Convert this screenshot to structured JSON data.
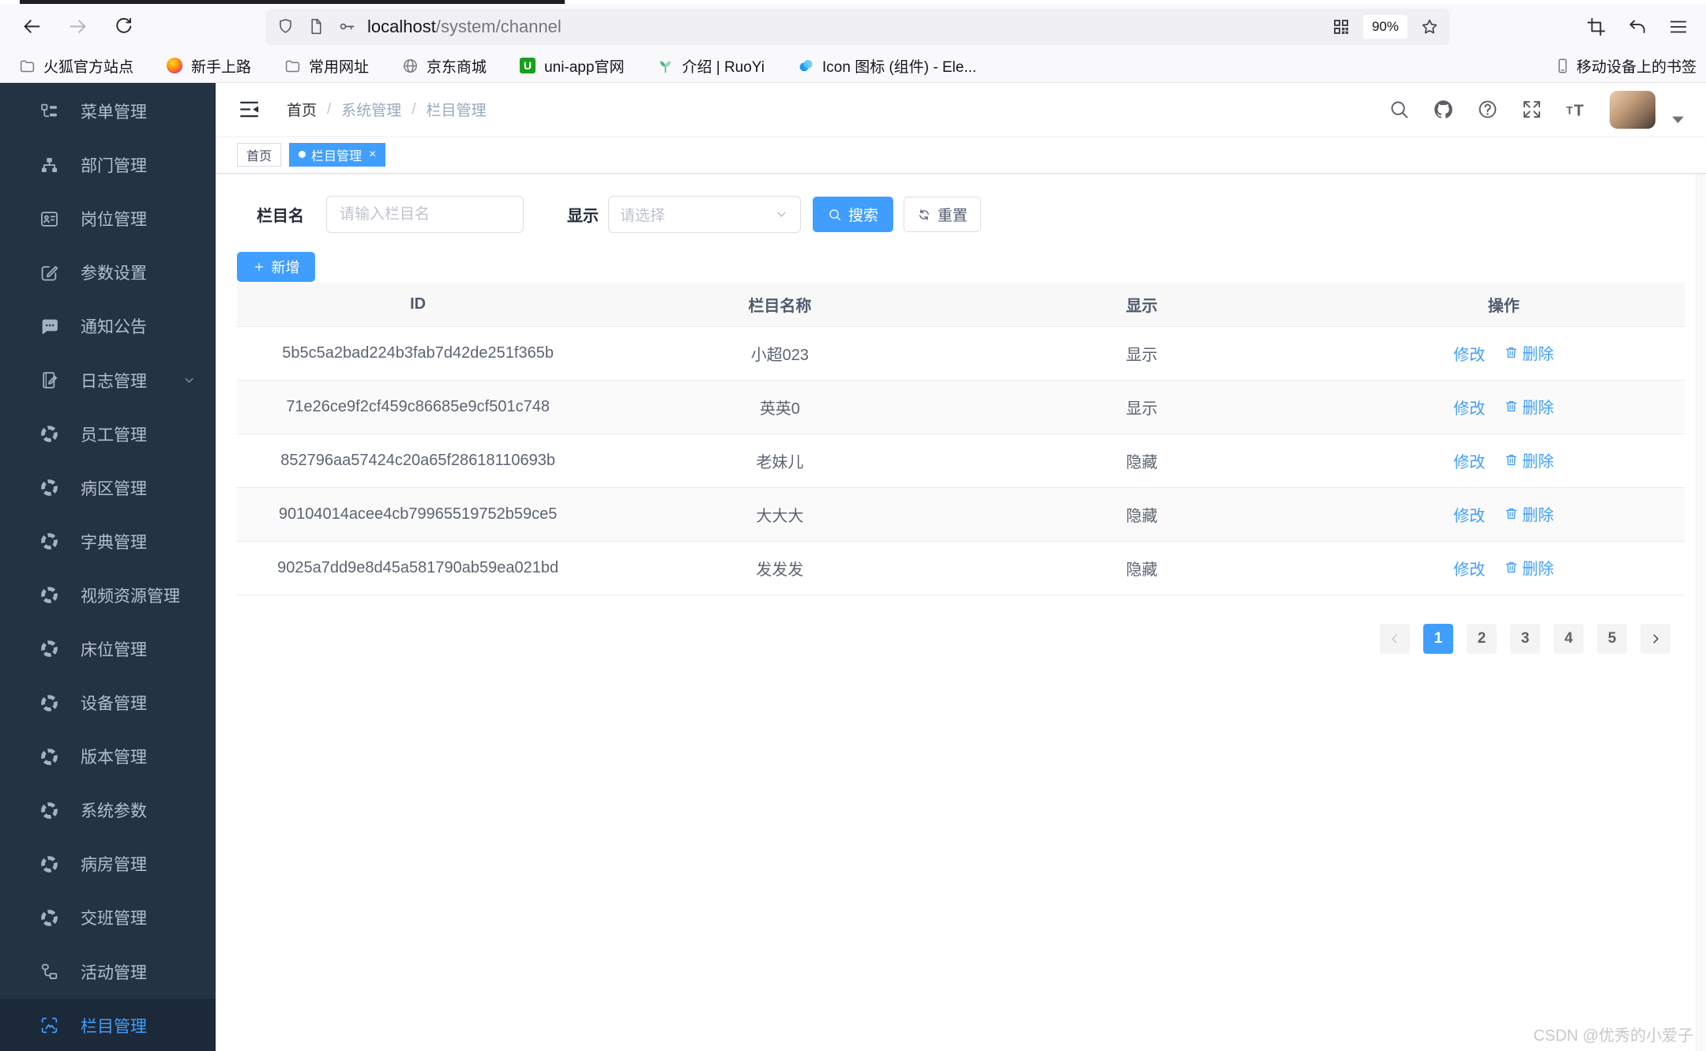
{
  "browser": {
    "toolbar": {
      "url_host": "localhost",
      "url_path": "/system/channel",
      "zoom_badge": "90%"
    },
    "bookmarks": [
      {
        "label": "火狐官方站点",
        "icon": "folder-icon"
      },
      {
        "label": "新手上路",
        "icon": "firefox-icon"
      },
      {
        "label": "常用网址",
        "icon": "folder-icon"
      },
      {
        "label": "京东商城",
        "icon": "globe-icon"
      },
      {
        "label": "uni-app官网",
        "icon": "uniapp-logo-icon"
      },
      {
        "label": "介绍 | RuoYi",
        "icon": "sprout-icon"
      },
      {
        "label": "Icon 图标 (组件) - Ele...",
        "icon": "element-logo-icon"
      }
    ],
    "bookmarks_device_label": "移动设备上的书签"
  },
  "sidebar": {
    "items": [
      {
        "label": "菜单管理",
        "icon": "tree-table-icon"
      },
      {
        "label": "部门管理",
        "icon": "org-chart-icon"
      },
      {
        "label": "岗位管理",
        "icon": "postcard-icon"
      },
      {
        "label": "参数设置",
        "icon": "edit-square-icon"
      },
      {
        "label": "通知公告",
        "icon": "message-icon"
      },
      {
        "label": "日志管理",
        "icon": "log-icon",
        "expandable": true
      },
      {
        "label": "员工管理",
        "icon": "guide-icon"
      },
      {
        "label": "病区管理",
        "icon": "guide-icon"
      },
      {
        "label": "字典管理",
        "icon": "guide-icon"
      },
      {
        "label": "视频资源管理",
        "icon": "guide-icon"
      },
      {
        "label": "床位管理",
        "icon": "guide-icon"
      },
      {
        "label": "设备管理",
        "icon": "guide-icon"
      },
      {
        "label": "版本管理",
        "icon": "guide-icon"
      },
      {
        "label": "系统参数",
        "icon": "guide-icon"
      },
      {
        "label": "病房管理",
        "icon": "guide-icon"
      },
      {
        "label": "交班管理",
        "icon": "guide-icon"
      },
      {
        "label": "活动管理",
        "icon": "activity-icon"
      },
      {
        "label": "栏目管理",
        "icon": "picture-icon",
        "active": true
      }
    ]
  },
  "navbar": {
    "breadcrumb": [
      "首页",
      "系统管理",
      "栏目管理"
    ]
  },
  "tags": [
    {
      "label": "首页",
      "active": false
    },
    {
      "label": "栏目管理",
      "active": true
    }
  ],
  "filter": {
    "name_label": "栏目名",
    "name_placeholder": "请输入栏目名",
    "display_label": "显示",
    "display_placeholder": "请选择",
    "search_label": "搜索",
    "reset_label": "重置"
  },
  "toolbar_actions": {
    "add_label": "新增"
  },
  "table": {
    "columns": [
      "ID",
      "栏目名称",
      "显示",
      "操作"
    ],
    "edit_label": "修改",
    "delete_label": "删除",
    "rows": [
      {
        "id": "5b5c5a2bad224b3fab7d42de251f365b",
        "name": "小超023",
        "display": "显示"
      },
      {
        "id": "71e26ce9f2cf459c86685e9cf501c748",
        "name": "英英0",
        "display": "显示"
      },
      {
        "id": "852796aa57424c20a65f28618110693b",
        "name": "老妹儿",
        "display": "隐藏"
      },
      {
        "id": "90104014acee4cb79965519752b59ce5",
        "name": "大大大",
        "display": "隐藏"
      },
      {
        "id": "9025a7dd9e8d45a581790ab59ea021bd",
        "name": "发发发",
        "display": "隐藏"
      }
    ]
  },
  "pagination": {
    "pages": [
      "1",
      "2",
      "3",
      "4",
      "5"
    ],
    "active_page": "1"
  },
  "watermark": "CSDN @优秀的小爱子",
  "colors": {
    "accent": "#409eff",
    "sidebar_bg": "#243343",
    "sidebar_active_bg": "#1c2938",
    "sidebar_text": "#b3bfcc",
    "table_header_bg": "#f8f8f9",
    "stripe_bg": "#fafafa",
    "browser_chrome_bg": "#f9f9fb",
    "url_field_bg": "#f0f0f4"
  }
}
